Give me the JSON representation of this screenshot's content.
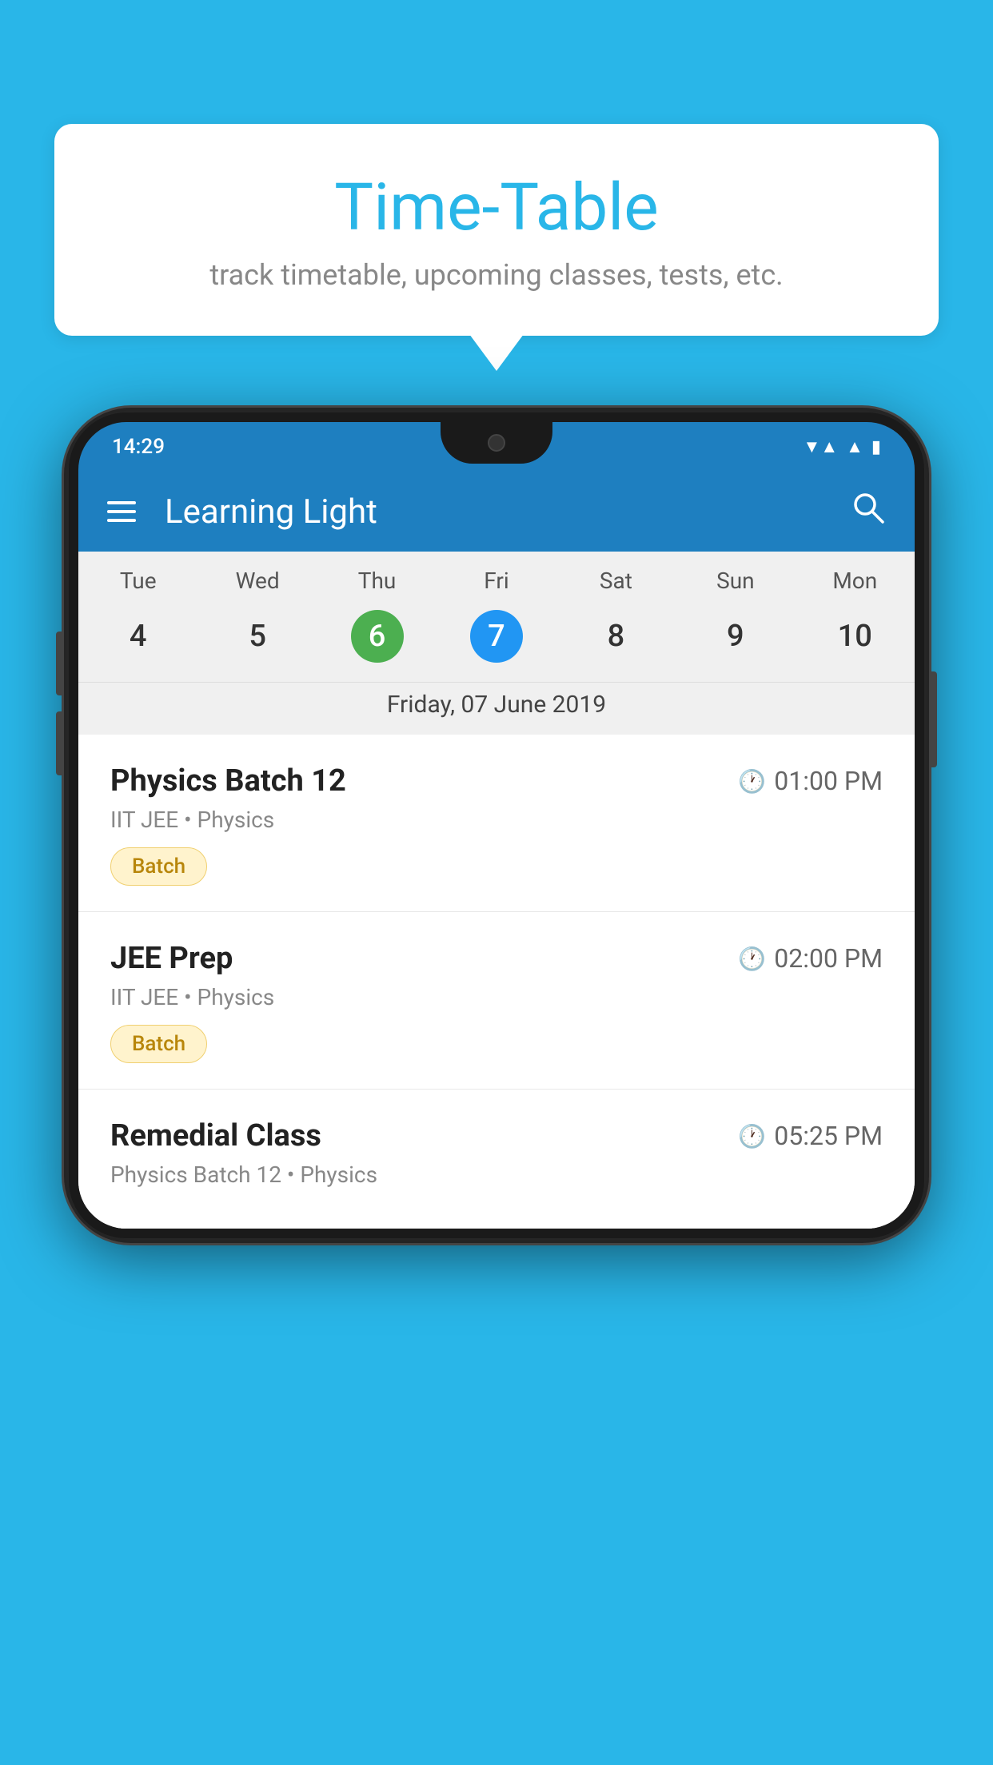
{
  "background_color": "#29B6E8",
  "bubble": {
    "title": "Time-Table",
    "subtitle": "track timetable, upcoming classes, tests, etc."
  },
  "app": {
    "title": "Learning Light",
    "status_time": "14:29",
    "selected_date_label": "Friday, 07 June 2019"
  },
  "calendar": {
    "days": [
      {
        "name": "Tue",
        "num": "4",
        "state": "normal"
      },
      {
        "name": "Wed",
        "num": "5",
        "state": "normal"
      },
      {
        "name": "Thu",
        "num": "6",
        "state": "today"
      },
      {
        "name": "Fri",
        "num": "7",
        "state": "selected"
      },
      {
        "name": "Sat",
        "num": "8",
        "state": "normal"
      },
      {
        "name": "Sun",
        "num": "9",
        "state": "normal"
      },
      {
        "name": "Mon",
        "num": "10",
        "state": "normal"
      }
    ]
  },
  "schedule": [
    {
      "title": "Physics Batch 12",
      "time": "01:00 PM",
      "subtitle": "IIT JEE • Physics",
      "tag": "Batch"
    },
    {
      "title": "JEE Prep",
      "time": "02:00 PM",
      "subtitle": "IIT JEE • Physics",
      "tag": "Batch"
    },
    {
      "title": "Remedial Class",
      "time": "05:25 PM",
      "subtitle": "Physics Batch 12 • Physics",
      "tag": ""
    }
  ]
}
